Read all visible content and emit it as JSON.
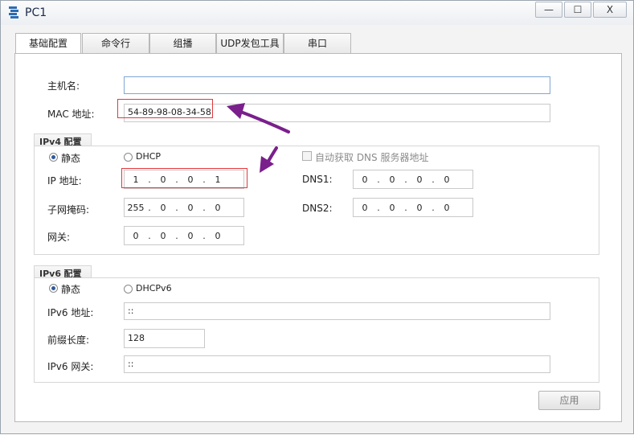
{
  "window": {
    "title": "PC1",
    "minimize_glyph": "—",
    "maximize_glyph": "☐",
    "close_glyph": "X"
  },
  "tabs": [
    {
      "label": "基础配置",
      "active": true
    },
    {
      "label": "命令行",
      "active": false
    },
    {
      "label": "组播",
      "active": false
    },
    {
      "label": "UDP发包工具",
      "active": false
    },
    {
      "label": "串口",
      "active": false
    }
  ],
  "basic": {
    "hostname_label": "主机名:",
    "hostname_value": "",
    "mac_label": "MAC 地址:",
    "mac_value": "54-89-98-08-34-58"
  },
  "ipv4": {
    "group_prefix": "IPv4",
    "group_suffix": "配置",
    "static_label": "静态",
    "dhcp_label": "DHCP",
    "auto_dns_label": "自动获取 DNS 服务器地址",
    "ip_label": "IP 地址:",
    "ip": [
      "1",
      "0",
      "0",
      "1"
    ],
    "mask_label": "子网掩码:",
    "mask": [
      "255",
      "0",
      "0",
      "0"
    ],
    "gateway_label": "网关:",
    "gateway": [
      "0",
      "0",
      "0",
      "0"
    ],
    "dns1_label": "DNS1:",
    "dns1": [
      "0",
      "0",
      "0",
      "0"
    ],
    "dns2_label": "DNS2:",
    "dns2": [
      "0",
      "0",
      "0",
      "0"
    ]
  },
  "ipv6": {
    "group_prefix": "IPv6",
    "group_suffix": "配置",
    "static_label": "静态",
    "dhcp_label": "DHCPv6",
    "addr_label": "IPv6 地址:",
    "addr_value": "::",
    "prefix_label": "前缀长度:",
    "prefix_value": "128",
    "gateway_label": "IPv6 网关:",
    "gateway_value": "::"
  },
  "apply_label": "应用",
  "colors": {
    "annotation_red": "#e0393d",
    "annotation_arrow": "#7a1f8c"
  }
}
